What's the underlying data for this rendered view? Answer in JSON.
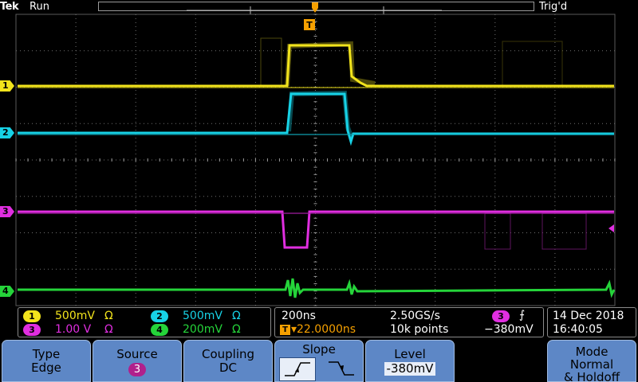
{
  "status": {
    "brand": "Tek",
    "run_state": "Run",
    "trigger_state": "Trig'd"
  },
  "trigger_marker": "T",
  "channels": {
    "ch1": {
      "number": "1",
      "scale": "500mV",
      "coupling_symbol": "Ω",
      "color": "#f2e41c"
    },
    "ch2": {
      "number": "2",
      "scale": "500mV",
      "coupling_symbol": "Ω",
      "color": "#17d2e6"
    },
    "ch3": {
      "number": "3",
      "scale": "1.00 V",
      "coupling_symbol": "Ω",
      "color": "#e02ee0"
    },
    "ch4": {
      "number": "4",
      "scale": "200mV",
      "coupling_symbol": "Ω",
      "color": "#25d43a"
    }
  },
  "timebase": {
    "time_per_div": "200ns",
    "sample_rate": "2.50GS/s",
    "position": "▾22.0000ns",
    "record_length": "10k points",
    "trigger_source": "3",
    "trigger_slope_symbol": "⨍",
    "trigger_level": "−380mV"
  },
  "datetime": {
    "date": "14 Dec 2018",
    "time": "16:40:05"
  },
  "softkeys": {
    "type": {
      "label": "Type",
      "value": "Edge"
    },
    "source": {
      "label": "Source",
      "value": "3"
    },
    "coupling": {
      "label": "Coupling",
      "value": "DC"
    },
    "slope": {
      "label": "Slope",
      "rising_icon": "rising-edge-icon",
      "falling_icon": "falling-edge-icon"
    },
    "level": {
      "label": "Level",
      "value": "-380mV"
    },
    "mode": {
      "label": "Mode",
      "value_line1": "Normal",
      "value_line2": "& Holdoff"
    }
  },
  "colors": {
    "softkey": "#5d87c6",
    "trigger_orange": "#f5a000",
    "grid": "#707070"
  }
}
